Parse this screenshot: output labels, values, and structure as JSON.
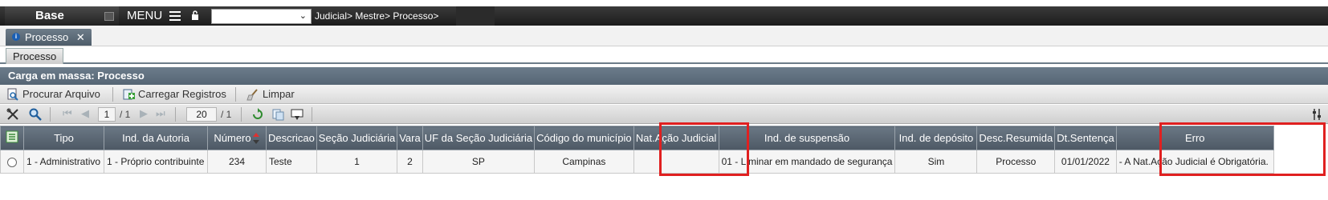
{
  "app": {
    "brand": "Base",
    "menu_label": "MENU",
    "breadcrumb": "Judicial> Mestre> Processo>"
  },
  "tabs": [
    {
      "label": "Processo",
      "close": "✕"
    }
  ],
  "subtab": {
    "label": "Processo"
  },
  "section": {
    "title": "Carga em massa: Processo"
  },
  "actions": {
    "browse": "Procurar Arquivo",
    "load": "Carregar Registros",
    "clear": "Limpar"
  },
  "pager": {
    "page": "1",
    "page_total": "/ 1",
    "rows": "20",
    "rows_total": "/ 1"
  },
  "table": {
    "headers": [
      "Tipo",
      "Ind. da Autoria",
      "Número",
      "Descricao",
      "Seção Judiciária",
      "Vara",
      "UF da Seção Judiciária",
      "Código do município",
      "Nat.Ação Judicial",
      "Ind. de suspensão",
      "Ind. de depósito",
      "Desc.Resumida",
      "Dt.Sentença",
      "Erro"
    ],
    "rows": [
      [
        "1 - Administrativo",
        "1 - Próprio contribuinte",
        "234",
        "Teste",
        "1",
        "2",
        "SP",
        "Campinas",
        "",
        "01 - Liminar em mandado de segurança",
        "Sim",
        "Processo",
        "01/01/2022",
        "- A Nat.Ação Judicial é Obrigatória."
      ]
    ]
  },
  "colors": {
    "highlight": "#e02020",
    "header_bg": "#5b6773",
    "topbar": "#222222"
  }
}
